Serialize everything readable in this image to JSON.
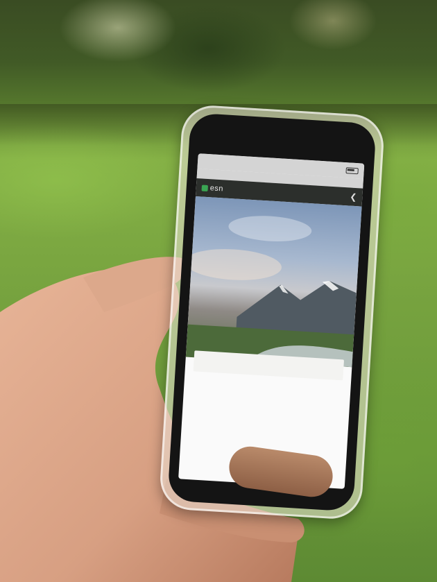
{
  "phone_screen": {
    "status_bar": {
      "carrier": "",
      "time": "",
      "url": ""
    },
    "app_header": {
      "logo_text": "esn",
      "share_icon": "share-icon"
    },
    "hero": {
      "title": "",
      "subtitle": ""
    },
    "card": {
      "heading": "",
      "body": "",
      "footnote": ""
    }
  },
  "colors": {
    "grass": "#77a33f",
    "hedge": "#3a4c23",
    "app_header": "#2c2f2c",
    "logo_accent": "#3aa553",
    "card_bg": "#f3f3f1"
  }
}
